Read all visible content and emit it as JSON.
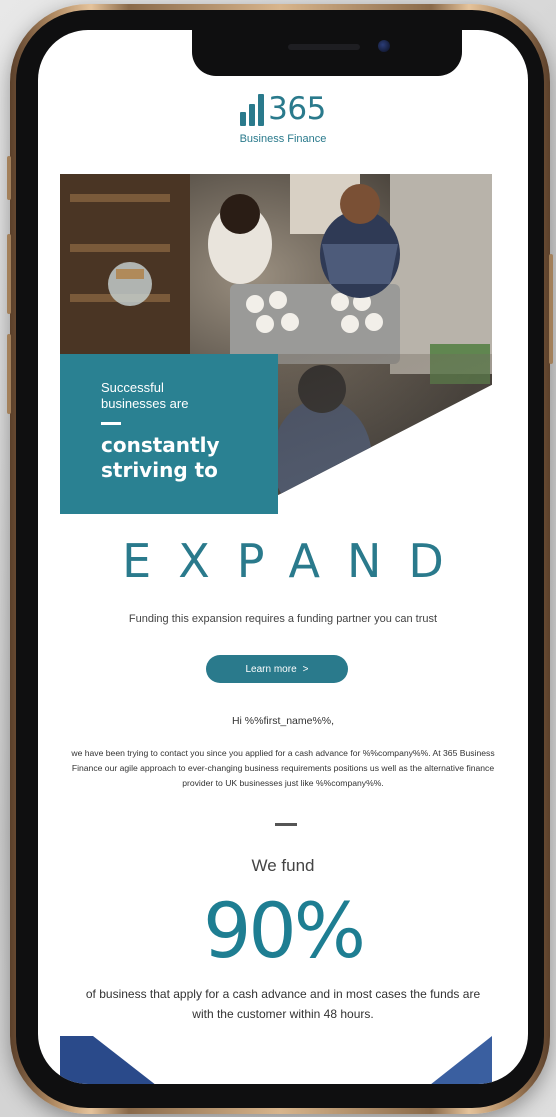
{
  "logo": {
    "number": "365",
    "subtitle": "Business Finance"
  },
  "hero": {
    "small_line1": "Successful",
    "small_line2": "businesses are",
    "big_line1": "constantly",
    "big_line2": "striving to"
  },
  "headline": "EXPAND",
  "tagline": "Funding this expansion requires a funding partner you can trust",
  "cta": {
    "label": "Learn more",
    "arrow": ">"
  },
  "greeting": "Hi %%first_name%%,",
  "body": "we have been trying to contact you since you applied for a cash advance for %%company%%. At 365 Business Finance our agile approach to ever-changing business requirements positions us well as the alternative finance provider to UK businesses just like %%company%%.",
  "stat": {
    "intro": "We fund",
    "value": "90%",
    "description": "of business that apply for a cash advance and in most cases the funds are with the customer within 48 hours."
  },
  "colors": {
    "brand": "#2a7a8c",
    "teal_box": "#2a8192",
    "frame_gold": "#d8b58c"
  },
  "icons": [
    "logo-bars-icon",
    "chevron-right-icon",
    "front-camera-icon",
    "speaker-icon"
  ]
}
